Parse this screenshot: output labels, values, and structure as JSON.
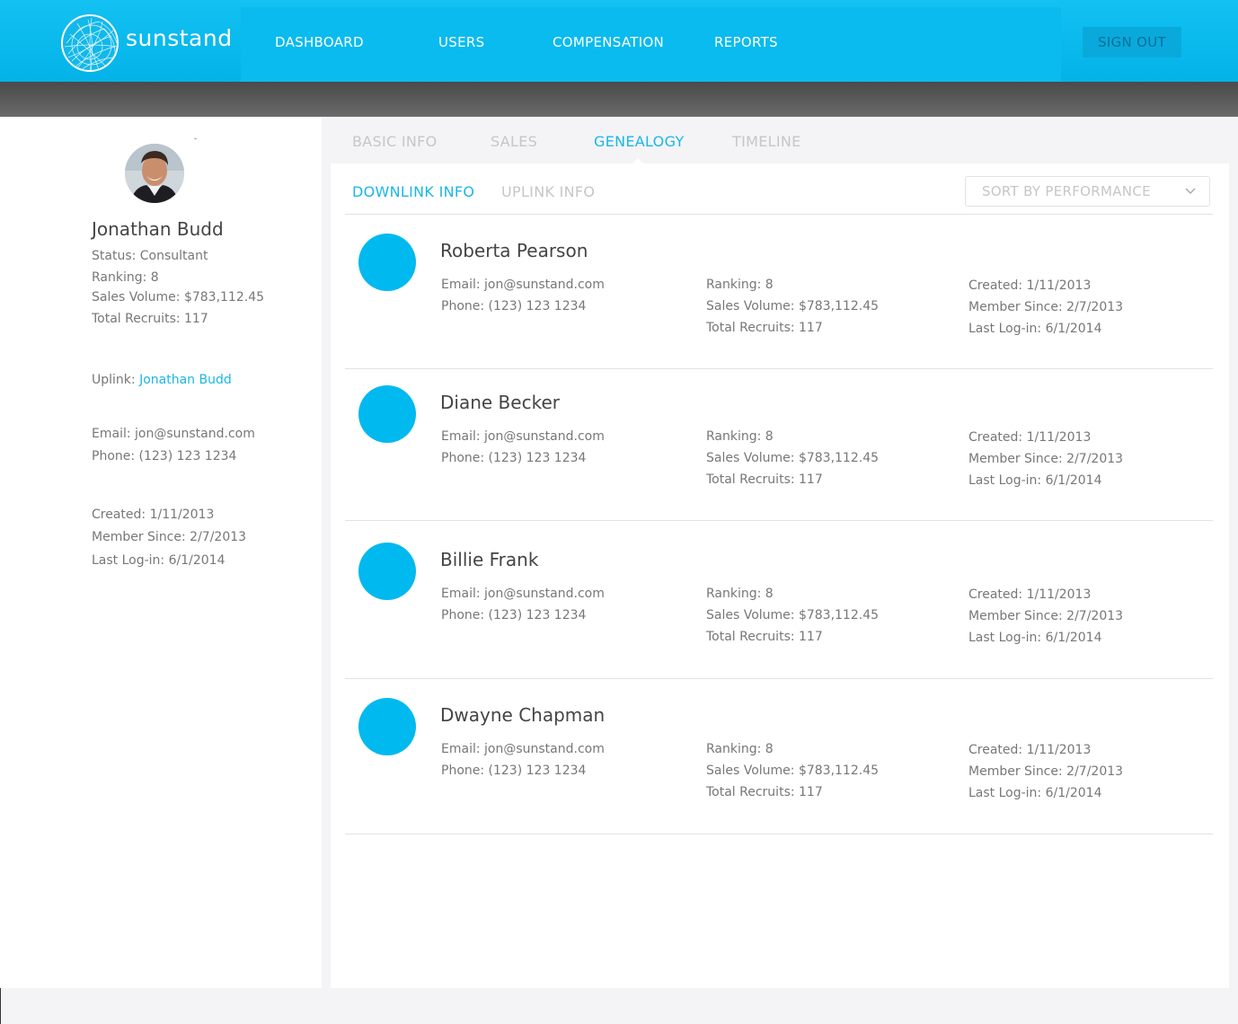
{
  "header": {
    "brand": "sunstand",
    "nav": [
      "DASHBOARD",
      "USERS",
      "COMPENSATION",
      "REPORTS"
    ],
    "sign_out": "SIGN OUT"
  },
  "profile": {
    "name": "Jonathan Budd",
    "status": "Status: Consultant",
    "ranking": "Ranking: 8",
    "sales_volume": "Sales Volume: $783,112.45",
    "total_recruits": "Total Recruits: 117",
    "uplink_label": "Uplink: ",
    "uplink_name": "Jonathan Budd",
    "email": "Email: jon@sunstand.com",
    "phone": "Phone: (123) 123 1234",
    "created": "Created: 1/11/2013",
    "member_since": "Member Since: 2/7/2013",
    "last_login": "Last Log-in: 6/1/2014"
  },
  "tabs": [
    "BASIC INFO",
    "SALES",
    "GENEALOGY",
    "TIMELINE"
  ],
  "active_tab": "GENEALOGY",
  "subtabs": [
    "DOWNLINK INFO",
    "UPLINK INFO"
  ],
  "sort": {
    "label": "SORT BY PERFORMANCE",
    "icon": "chevron-down-icon"
  },
  "accent_color": "#00b9ef",
  "downlinks": [
    {
      "name": "Roberta Pearson",
      "email": "Email: jon@sunstand.com",
      "phone": "Phone: (123) 123 1234",
      "ranking": "Ranking: 8",
      "sales_volume": "Sales Volume: $783,112.45",
      "total_recruits": "Total Recruits: 117",
      "created": "Created: 1/11/2013",
      "member_since": "Member Since: 2/7/2013",
      "last_login": "Last Log-in: 6/1/2014"
    },
    {
      "name": "Diane Becker",
      "email": "Email: jon@sunstand.com",
      "phone": "Phone: (123) 123 1234",
      "ranking": "Ranking: 8",
      "sales_volume": "Sales Volume: $783,112.45",
      "total_recruits": "Total Recruits: 117",
      "created": "Created: 1/11/2013",
      "member_since": "Member Since: 2/7/2013",
      "last_login": "Last Log-in: 6/1/2014"
    },
    {
      "name": "Billie Frank",
      "email": "Email: jon@sunstand.com",
      "phone": "Phone: (123) 123 1234",
      "ranking": "Ranking: 8",
      "sales_volume": "Sales Volume: $783,112.45",
      "total_recruits": "Total Recruits: 117",
      "created": "Created: 1/11/2013",
      "member_since": "Member Since: 2/7/2013",
      "last_login": "Last Log-in: 6/1/2014"
    },
    {
      "name": "Dwayne Chapman",
      "email": "Email: jon@sunstand.com",
      "phone": "Phone: (123) 123 1234",
      "ranking": "Ranking: 8",
      "sales_volume": "Sales Volume: $783,112.45",
      "total_recruits": "Total Recruits: 117",
      "created": "Created: 1/11/2013",
      "member_since": "Member Since: 2/7/2013",
      "last_login": "Last Log-in: 6/1/2014"
    }
  ]
}
